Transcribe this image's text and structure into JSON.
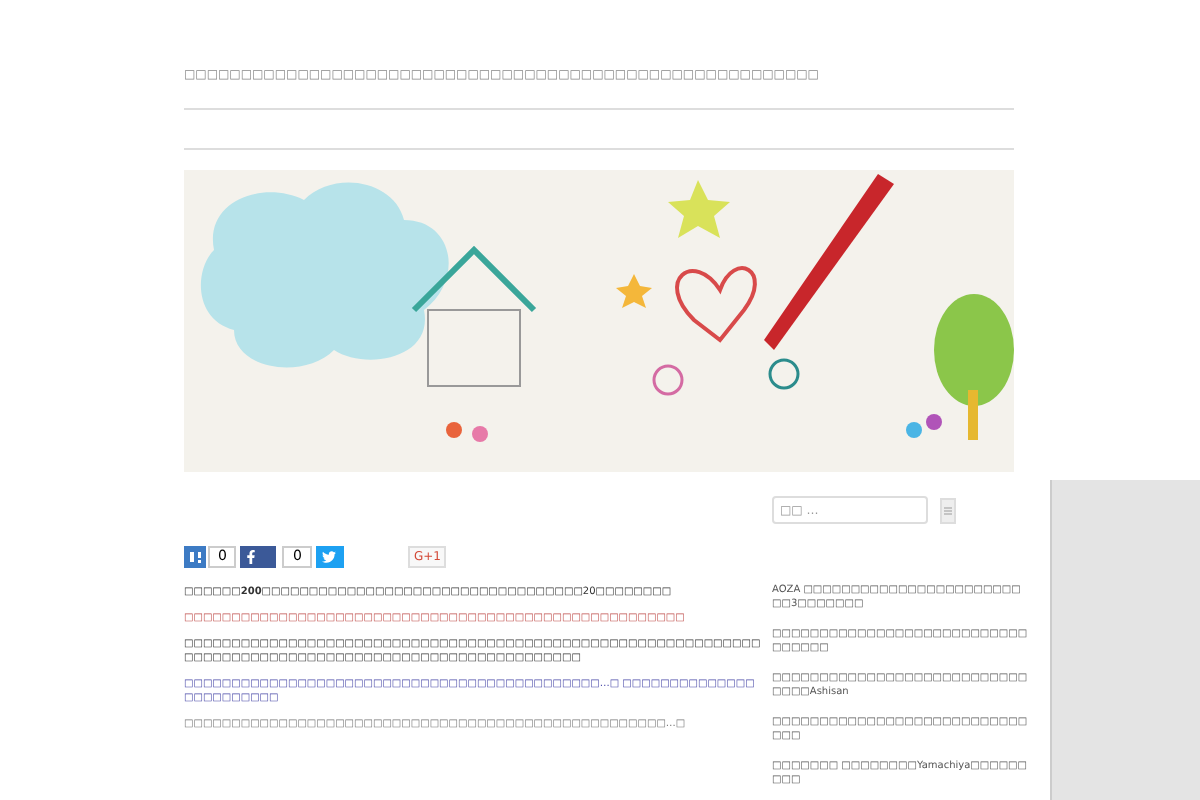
{
  "site_description": "□□□□□□□□□□□□□□□□□□□□□□□□□□□□□□□□□□□□□□□□□□□□□□□□□□□□□□□□",
  "share_buttons": [
    {
      "kind": "hatena",
      "count": "0"
    },
    {
      "kind": "facebook",
      "count": "0"
    },
    {
      "kind": "twitter"
    },
    {
      "kind": "gplus",
      "label": "G+1"
    }
  ],
  "article_paragraphs": [
    {
      "kind": "text",
      "text": "□□□□□□**200□□□□□□□**□□□□□□□□□□□□□□□□□□□□□□□□□□□20□□□□□□□□"
    },
    {
      "kind": "warning",
      "text": "□□□□□□□□□□□□□□□□□□□□□□□□□□□□□□□□□□□□□□□□□□□□□□□□□□□□□"
    },
    {
      "kind": "text",
      "text": "□□□□□□□□□□□□□□□□□□□□□□□□□□□□□□□□□□□□□□□□□□□□□□□□□□□□□□□□□□□□□□□□□□□□□□□□□□□□□□□□□□□□□□□□□□□□□□□□□□□□□□□"
    },
    {
      "kind": "link",
      "text": "□□□□□□□□□□□□□□□□□□□□□□□□□□□□□□□□□□□□□□□□□□□□…□ □□□□□□□□□□□□□□□□□□□□□□□□"
    },
    {
      "kind": "muted",
      "text": "□□□□□□□□□□□□□□□□□□□□□□□□□□□□□□□□□□□□□□□□□□□□□□□□□□□…□"
    }
  ],
  "search": {
    "placeholder": "□□ …"
  },
  "sidebar_posts": [
    "AOZA □□□□□□□□□□□□□□□□□□□□□□□□□3□□□□□□□",
    "□□□□□□□□□□□□□□□□□□□□□□□□□□□□□□□□□",
    "□□□□□□□□□□□□□□□□□□□□□□□□□□□□□□□Ashisan",
    "□□□□□□□□□□□□□□□□□□□□□□□□□□□□□□",
    "□□□□□□□ □□□□□□□□Yamachiya□□□□□□□□□"
  ]
}
